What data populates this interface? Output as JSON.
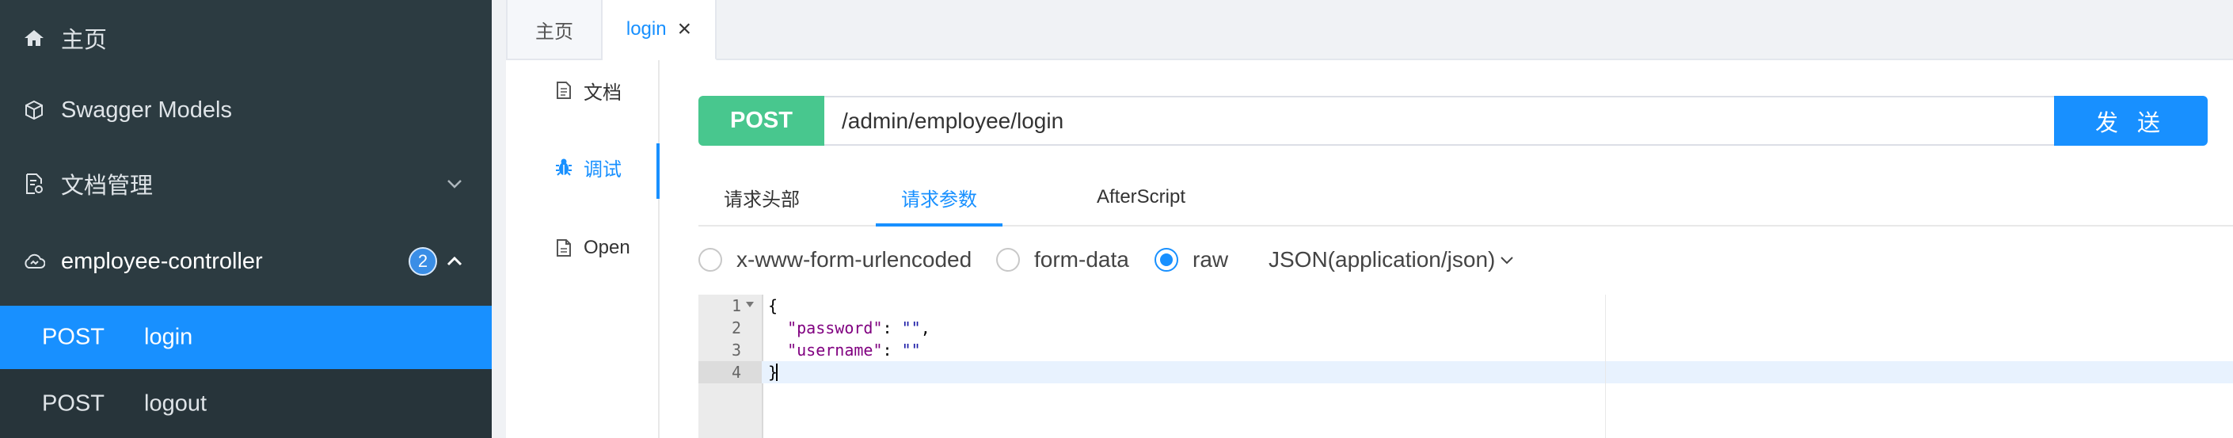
{
  "sidebar": {
    "items": [
      {
        "label": "主页",
        "icon": "home-icon"
      },
      {
        "label": "Swagger Models",
        "icon": "cube-icon"
      },
      {
        "label": "文档管理",
        "icon": "document-settings-icon"
      },
      {
        "label": "employee-controller",
        "icon": "cloud-icon",
        "badge": "2"
      }
    ],
    "endpoints": [
      {
        "method": "POST",
        "name": "login",
        "active": true
      },
      {
        "method": "POST",
        "name": "logout",
        "active": false
      }
    ]
  },
  "tabs": [
    {
      "label": "主页"
    },
    {
      "label": "login",
      "close": "×",
      "active": true
    }
  ],
  "leftnav": {
    "items": [
      {
        "label": "文档",
        "icon": "document-icon"
      },
      {
        "label": "调试",
        "icon": "bug-icon",
        "active": true
      },
      {
        "label": "Open",
        "icon": "file-icon"
      }
    ]
  },
  "request": {
    "method": "POST",
    "url": "/admin/employee/login",
    "send_label": "发 送"
  },
  "param_tabs": [
    {
      "label": "请求头部"
    },
    {
      "label": "请求参数",
      "active": true
    },
    {
      "label": "AfterScript"
    }
  ],
  "body_types": [
    {
      "label": "x-www-form-urlencoded",
      "selected": false
    },
    {
      "label": "form-data",
      "selected": false
    },
    {
      "label": "raw",
      "selected": true
    }
  ],
  "content_type": "JSON(application/json)",
  "editor": {
    "line_numbers": [
      "1",
      "2",
      "3",
      "4"
    ],
    "lines": {
      "l1": "{",
      "l2_key": "\"password\"",
      "l2_sep": ": ",
      "l2_val": "\"\"",
      "l2_end": ",",
      "l3_key": "\"username\"",
      "l3_sep": ": ",
      "l3_val": "\"\"",
      "l4": "}"
    }
  },
  "colors": {
    "sidebar_bg": "#2c3b41",
    "active_blue": "#1890ff",
    "post_green": "#48c78e"
  }
}
